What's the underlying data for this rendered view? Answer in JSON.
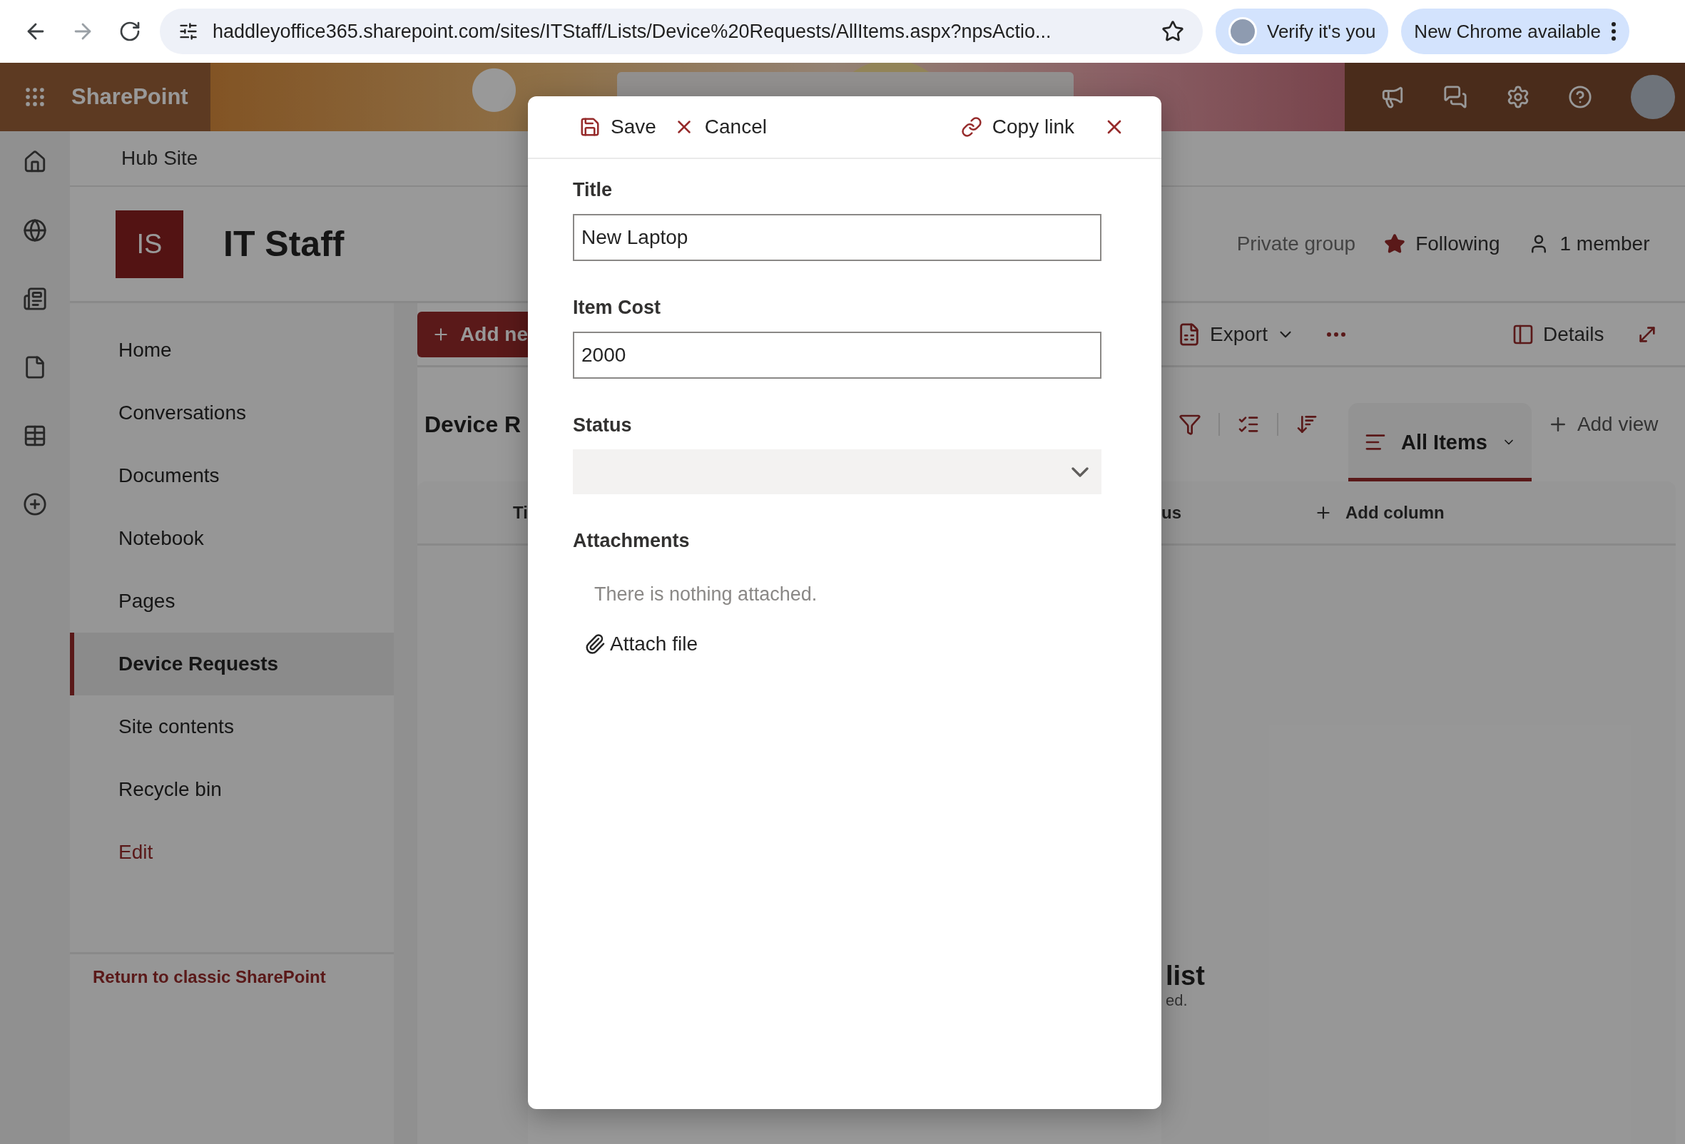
{
  "browser": {
    "url": "haddleyoffice365.sharepoint.com/sites/ITStaff/Lists/Device%20Requests/AllItems.aspx?npsActio...",
    "verify_button": "Verify it's you",
    "update_button": "New Chrome available"
  },
  "suite_bar": {
    "app_name": "SharePoint"
  },
  "hub": {
    "label": "Hub Site"
  },
  "site": {
    "logo_initials": "IS",
    "title": "IT Staff",
    "privacy": "Private group",
    "follow": {
      "label": "Following",
      "following": true
    },
    "members": "1 member"
  },
  "nav": {
    "items": [
      {
        "label": "Home",
        "selected": false
      },
      {
        "label": "Conversations",
        "selected": false
      },
      {
        "label": "Documents",
        "selected": false
      },
      {
        "label": "Notebook",
        "selected": false
      },
      {
        "label": "Pages",
        "selected": false
      },
      {
        "label": "Device Requests",
        "selected": true
      },
      {
        "label": "Site contents",
        "selected": false
      },
      {
        "label": "Recycle bin",
        "selected": false
      }
    ],
    "edit_link": "Edit",
    "classic_link": "Return to classic SharePoint"
  },
  "command_bar": {
    "add_button": "Add ne",
    "export": "Export",
    "details": "Details"
  },
  "list": {
    "heading": "Device R",
    "view_tabs": [
      {
        "label": "All Items",
        "selected": true
      }
    ],
    "add_view": "Add view",
    "columns": [
      "Ti",
      "us"
    ],
    "add_column": "Add column",
    "empty_title": "list",
    "empty_subtitle": "ed."
  },
  "form": {
    "actions": {
      "save": "Save",
      "cancel": "Cancel",
      "copy_link": "Copy link"
    },
    "fields": [
      {
        "kind": "text",
        "label": "Title",
        "value": "New Laptop"
      },
      {
        "kind": "text",
        "label": "Item Cost",
        "value": "2000"
      },
      {
        "kind": "choice",
        "label": "Status"
      }
    ],
    "attachments": {
      "label": "Attachments",
      "empty_text": "There is nothing attached.",
      "attach_button": "Attach file"
    }
  }
}
